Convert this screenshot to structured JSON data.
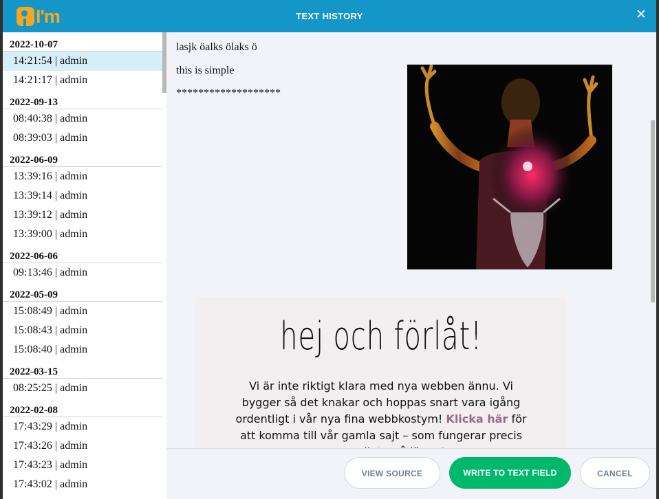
{
  "window": {
    "logo_text": "I'm",
    "title": "TEXT HISTORY",
    "close_symbol": "✕"
  },
  "history": [
    {
      "date": "2022-10-07",
      "entries": [
        "14:21:54 | admin",
        "14:21:17 | admin"
      ]
    },
    {
      "date": "2022-09-13",
      "entries": [
        "08:40:38 | admin",
        "08:39:03 | admin"
      ]
    },
    {
      "date": "2022-06-09",
      "entries": [
        "13:39:16 | admin",
        "13:39:14 | admin",
        "13:39:12 | admin",
        "13:39:00 | admin"
      ]
    },
    {
      "date": "2022-06-06",
      "entries": [
        "09:13:46 | admin"
      ]
    },
    {
      "date": "2022-05-09",
      "entries": [
        "15:08:49 | admin",
        "15:08:43 | admin",
        "15:08:40 | admin"
      ]
    },
    {
      "date": "2022-03-15",
      "entries": [
        "08:25:25 | admin"
      ]
    },
    {
      "date": "2022-02-08",
      "entries": [
        "17:43:29 | admin",
        "17:43:26 | admin",
        "17:43:23 | admin",
        "17:43:02 | admin"
      ]
    }
  ],
  "selected_entry": "14:21:54 | admin",
  "preview": {
    "lines": [
      "lasjk öalks ölaks ö",
      "this is simple",
      "*******************"
    ],
    "embed_heading": "hej och förlåt!",
    "embed_text_before": "Vi är inte riktigt klara med nya webben ännu. Vi bygger så det knakar och hoppas snart vara igång ordentligt i vår nya fina webbkostym! ",
    "embed_link": "Klicka här",
    "embed_text_after": " för att komma till vår gamla sajt – som fungerar precis som vanligt – så länge!"
  },
  "buttons": {
    "view_source": "VIEW SOURCE",
    "write_to_field": "WRITE TO TEXT FIELD",
    "cancel": "CANCEL"
  },
  "colors": {
    "titlebar": "#1496c8",
    "logo": "#f5a623",
    "selected_row": "#d6eef8",
    "primary_button": "#00b86b",
    "link": "#9b6a86"
  }
}
